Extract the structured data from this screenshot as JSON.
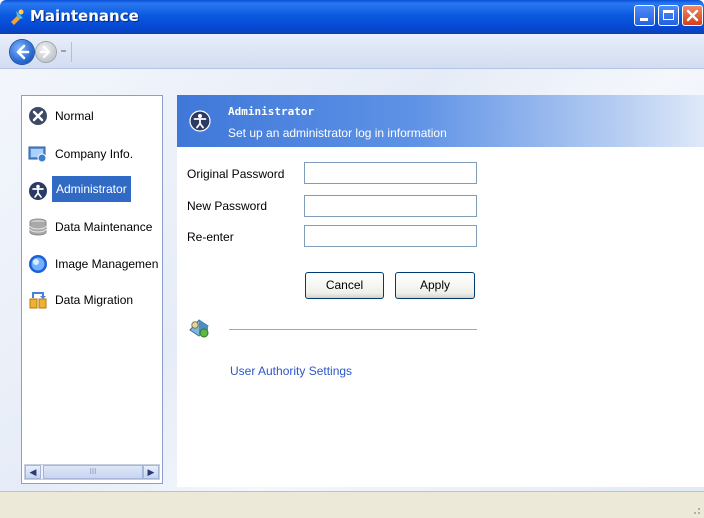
{
  "window": {
    "title": "Maintenance"
  },
  "sidebar": {
    "items": [
      {
        "label": "Normal",
        "icon": "normal-icon"
      },
      {
        "label": "Company Info.",
        "icon": "company-info-icon"
      },
      {
        "label": "Administrator",
        "icon": "administrator-icon",
        "selected": true
      },
      {
        "label": "Data Maintenance",
        "icon": "database-icon"
      },
      {
        "label": "Image Managemen",
        "icon": "image-management-icon"
      },
      {
        "label": "Data Migration",
        "icon": "data-migration-icon"
      }
    ],
    "scroll_thumb_label": "III"
  },
  "panel": {
    "title": "Administrator",
    "subtitle": "Set up an administrator log in information"
  },
  "form": {
    "original_password_label": "Original Password",
    "new_password_label": "New Password",
    "reenter_label": "Re-enter",
    "original_password_value": "",
    "new_password_value": "",
    "reenter_value": "",
    "cancel_label": "Cancel",
    "apply_label": "Apply"
  },
  "links": {
    "user_authority": "User Authority Settings"
  },
  "colors": {
    "titlebar": "#0a5ae0",
    "selection": "#316ac5",
    "link": "#2b58c8",
    "header_start": "#3f78d9"
  }
}
